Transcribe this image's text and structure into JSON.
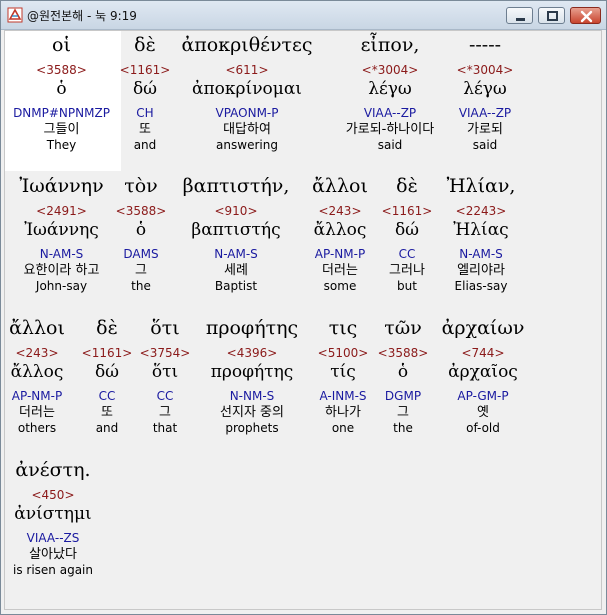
{
  "window": {
    "title": "@원전본해 - 눅 9:19",
    "icon": "app-logo-icon",
    "controls": [
      "minimize-icon",
      "maximize-icon",
      "close-icon"
    ]
  },
  "rows": [
    [
      {
        "greek": "οἱ",
        "strong": "<3588>",
        "lemma": "ὁ",
        "morph": "DNMP#NPNMZP",
        "korean": "그들이",
        "english": "They"
      },
      {
        "greek": "δὲ",
        "strong": "<1161>",
        "lemma": "δώ",
        "morph": "CH",
        "korean": "또",
        "english": "and"
      },
      {
        "greek": "ἀποκριθέντες",
        "strong": "<611>",
        "lemma": "ἀποκρίνομαι",
        "morph": "VPAONM-P",
        "korean": "대답하여",
        "english": "answering"
      },
      {
        "greek": "εἶπον,",
        "strong": "<*3004>",
        "lemma": "λέγω",
        "morph": "VIAA--ZP",
        "korean": "가로되-하나이다",
        "english": "said"
      },
      {
        "greek": "-----",
        "strong": "<*3004>",
        "lemma": "λέγω",
        "morph": "VIAA--ZP",
        "korean": "가로되",
        "english": "said"
      }
    ],
    [
      {
        "greek": "Ἰωάννην",
        "strong": "<2491>",
        "lemma": "Ἰωάννης",
        "morph": "N-AM-S",
        "korean": "요한이라 하고",
        "english": "John-say"
      },
      {
        "greek": "τὸν",
        "strong": "<3588>",
        "lemma": "ὁ",
        "morph": "DAMS",
        "korean": "그",
        "english": "the"
      },
      {
        "greek": "βαπτιστήν,",
        "strong": "<910>",
        "lemma": "βαπτιστής",
        "morph": "N-AM-S",
        "korean": "세례",
        "english": "Baptist"
      },
      {
        "greek": "ἄλλοι",
        "strong": "<243>",
        "lemma": "ἄλλος",
        "morph": "AP-NM-P",
        "korean": "더러는",
        "english": "some"
      },
      {
        "greek": "δὲ",
        "strong": "<1161>",
        "lemma": "δώ",
        "morph": "CC",
        "korean": "그러나",
        "english": "but"
      },
      {
        "greek": "Ἠλίαν,",
        "strong": "<2243>",
        "lemma": "Ἠλίας",
        "morph": "N-AM-S",
        "korean": "엘리야라",
        "english": "Elias-say"
      }
    ],
    [
      {
        "greek": "ἄλλοι",
        "strong": "<243>",
        "lemma": "ἄλλος",
        "morph": "AP-NM-P",
        "korean": "더러는",
        "english": "others"
      },
      {
        "greek": "δὲ",
        "strong": "<1161>",
        "lemma": "δώ",
        "morph": "CC",
        "korean": "또",
        "english": "and"
      },
      {
        "greek": "ὅτι",
        "strong": "<3754>",
        "lemma": "ὅτι",
        "morph": "CC",
        "korean": "그",
        "english": "that"
      },
      {
        "greek": "προφήτης",
        "strong": "<4396>",
        "lemma": "προφήτης",
        "morph": "N-NM-S",
        "korean": "선지자 중의",
        "english": "prophets"
      },
      {
        "greek": "τις",
        "strong": "<5100>",
        "lemma": "τίς",
        "morph": "A-INM-S",
        "korean": "하나가",
        "english": "one"
      },
      {
        "greek": "τῶν",
        "strong": "<3588>",
        "lemma": "ὁ",
        "morph": "DGMP",
        "korean": "그",
        "english": "the"
      },
      {
        "greek": "ἀρχαίων",
        "strong": "<744>",
        "lemma": "ἀρχαῖος",
        "morph": "AP-GM-P",
        "korean": "옛",
        "english": "of-old"
      }
    ],
    [
      {
        "greek": "ἀνέστη.",
        "strong": "<450>",
        "lemma": "ἀνίστημι",
        "morph": "VIAA--ZS",
        "korean": "살아났다",
        "english": "is risen again"
      }
    ]
  ],
  "colors": {
    "strong_number": "#8b1a1a",
    "morphology": "#1a1aa0",
    "text": "#000000",
    "highlight_background": "#ffffff",
    "panel_background": "#f0f0f0"
  }
}
